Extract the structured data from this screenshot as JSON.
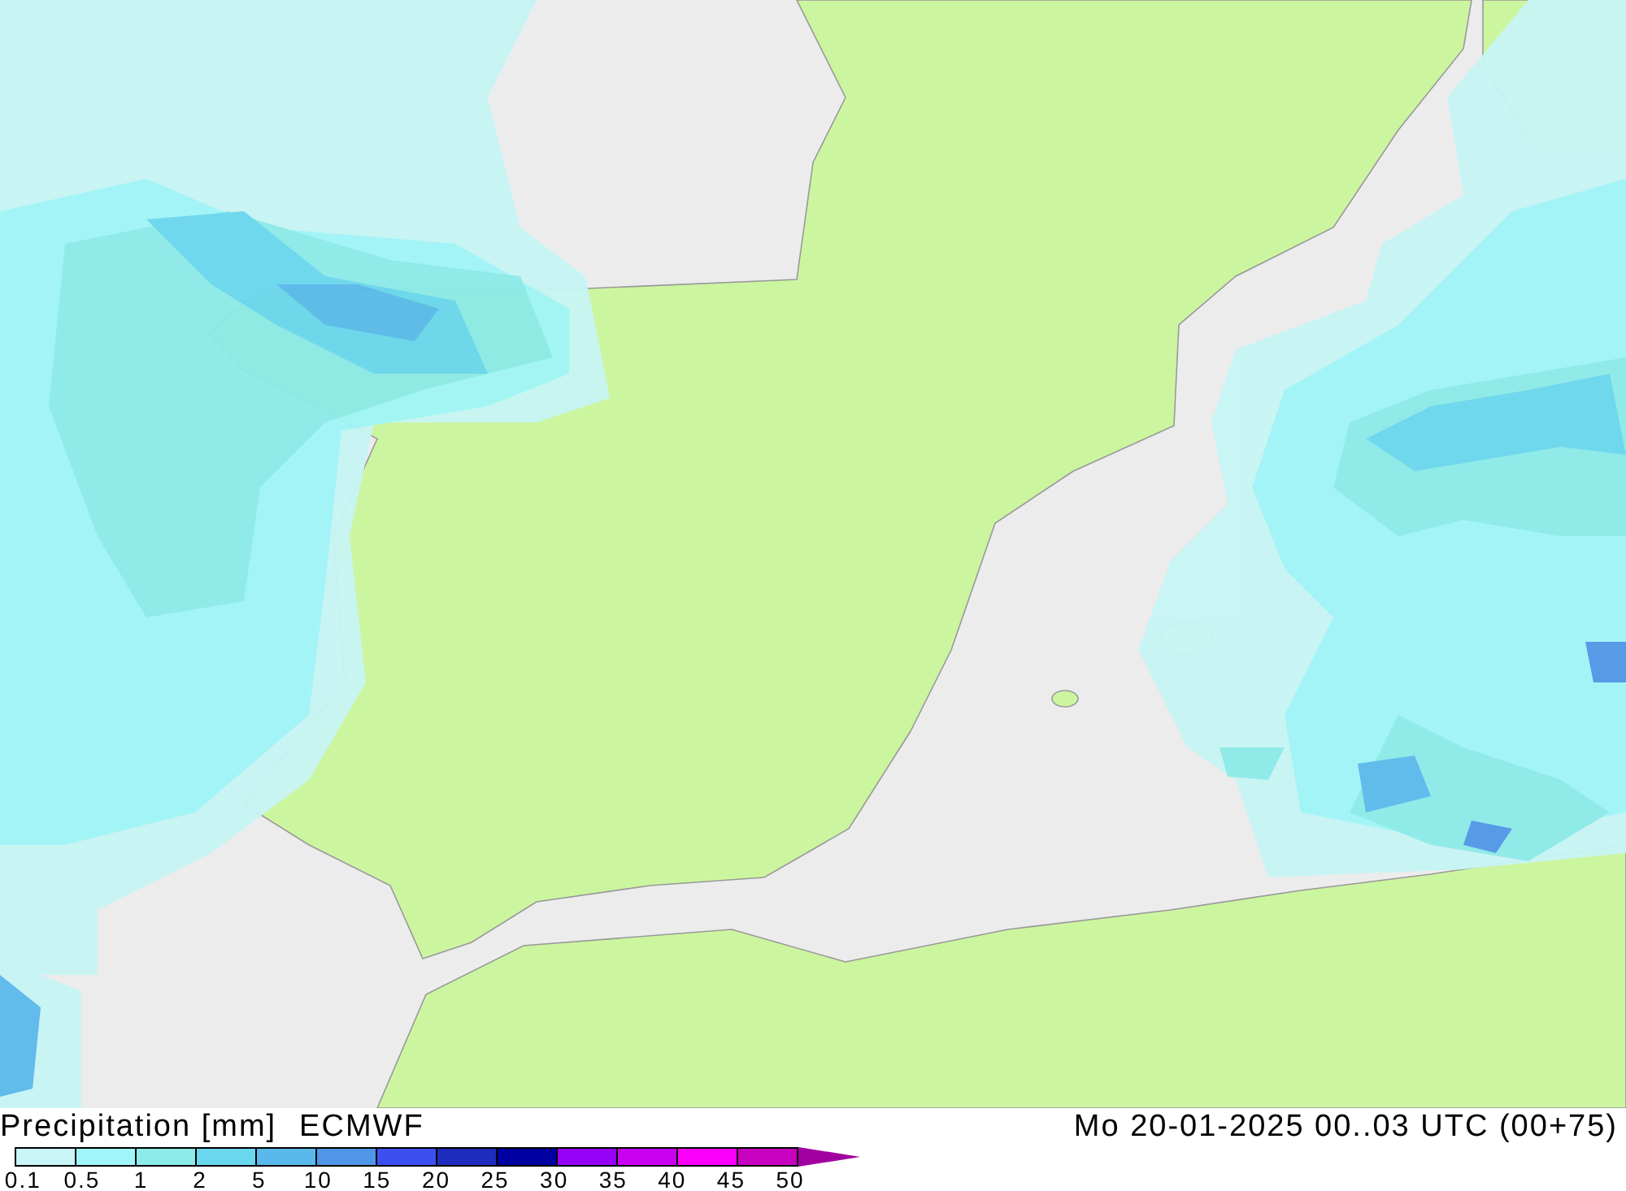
{
  "map": {
    "kind": "precipitation"
  },
  "footer": {
    "title": "Precipitation [mm]",
    "model": "ECMWF",
    "valid_time": "Mo 20-01-2025 00..03 UTC (00+75)"
  },
  "legend": {
    "bins": [
      {
        "color": "#c8f5f5"
      },
      {
        "color": "#a0f5f8"
      },
      {
        "color": "#8ceae8"
      },
      {
        "color": "#6ad7ee"
      },
      {
        "color": "#5ab9eb"
      },
      {
        "color": "#5096e6"
      },
      {
        "color": "#3c50f0"
      },
      {
        "color": "#1e2dbe"
      },
      {
        "color": "#0000a0"
      },
      {
        "color": "#9600f5"
      },
      {
        "color": "#c800f0"
      },
      {
        "color": "#fa00fa"
      },
      {
        "color": "#c800c0"
      }
    ],
    "overflow": {
      "color": "#a000a0"
    },
    "labels": [
      "0.1",
      "0.5",
      "1",
      "2",
      "5",
      "10",
      "15",
      "20",
      "25",
      "30",
      "35",
      "40",
      "45",
      "50"
    ]
  }
}
